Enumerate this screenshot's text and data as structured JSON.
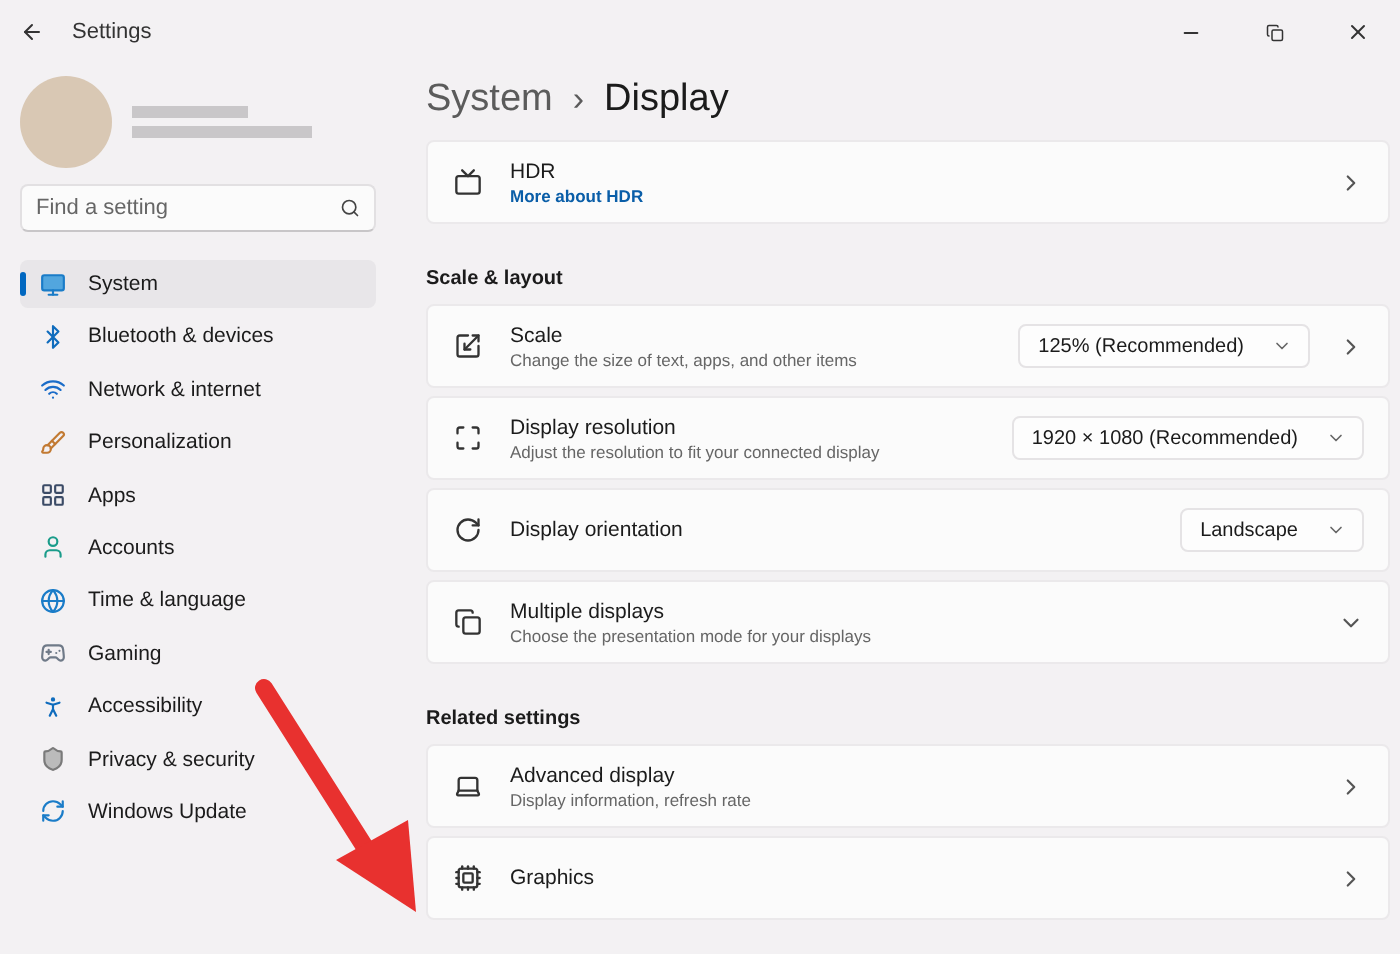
{
  "window": {
    "title": "Settings"
  },
  "search": {
    "placeholder": "Find a setting"
  },
  "nav": [
    {
      "label": "System",
      "selected": true
    },
    {
      "label": "Bluetooth & devices",
      "selected": false
    },
    {
      "label": "Network & internet",
      "selected": false
    },
    {
      "label": "Personalization",
      "selected": false
    },
    {
      "label": "Apps",
      "selected": false
    },
    {
      "label": "Accounts",
      "selected": false
    },
    {
      "label": "Time & language",
      "selected": false
    },
    {
      "label": "Gaming",
      "selected": false
    },
    {
      "label": "Accessibility",
      "selected": false
    },
    {
      "label": "Privacy & security",
      "selected": false
    },
    {
      "label": "Windows Update",
      "selected": false
    }
  ],
  "breadcrumb": {
    "parent": "System",
    "separator": "›",
    "current": "Display"
  },
  "sections": [
    {
      "rows": [
        {
          "kind": "navigate",
          "title": "HDR",
          "link": "More about HDR"
        }
      ]
    },
    {
      "heading": "Scale & layout",
      "rows": [
        {
          "kind": "navigate",
          "title": "Scale",
          "subtitle": "Change the size of text, apps, and other items",
          "dropdown": "125% (Recommended)"
        },
        {
          "kind": "select",
          "title": "Display resolution",
          "subtitle": "Adjust the resolution to fit your connected display",
          "dropdown": "1920 × 1080 (Recommended)"
        },
        {
          "kind": "select",
          "title": "Display orientation",
          "dropdown": "Landscape"
        },
        {
          "kind": "expand",
          "title": "Multiple displays",
          "subtitle": "Choose the presentation mode for your displays"
        }
      ]
    },
    {
      "heading": "Related settings",
      "rows": [
        {
          "kind": "navigate",
          "title": "Advanced display",
          "subtitle": "Display information, refresh rate"
        },
        {
          "kind": "navigate",
          "title": "Graphics"
        }
      ]
    }
  ]
}
